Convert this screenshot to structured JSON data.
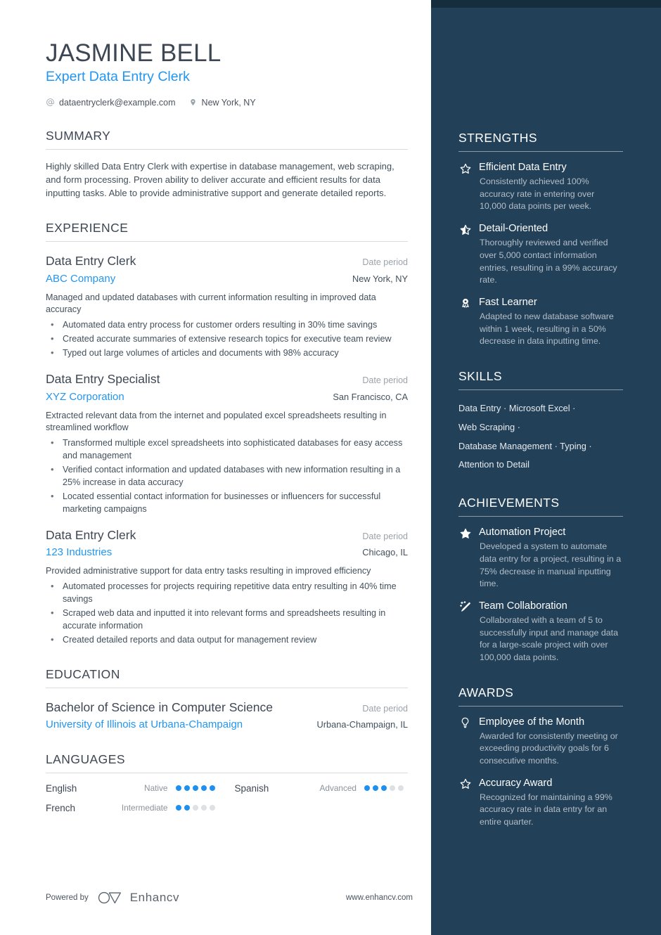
{
  "header": {
    "name": "JASMINE BELL",
    "role": "Expert Data Entry Clerk",
    "email": "dataentryclerk@example.com",
    "location": "New York, NY",
    "email_icon": "at-icon",
    "location_icon": "map-pin-icon"
  },
  "accent_color": "#2196f3",
  "sidebar_color": "#224058",
  "sidebar_topbar_color": "#162d3e",
  "summary": {
    "title": "SUMMARY",
    "text": "Highly skilled Data Entry Clerk with expertise in database management, web scraping, and form processing. Proven ability to deliver accurate and efficient results for data inputting tasks. Able to provide administrative support and generate detailed reports."
  },
  "experience": {
    "title": "EXPERIENCE",
    "entries": [
      {
        "title": "Data Entry Clerk",
        "date": "Date period",
        "org": "ABC Company",
        "location": "New York, NY",
        "desc": "Managed and updated databases with current information resulting in improved data accuracy",
        "bullets": [
          "Automated data entry process for customer orders resulting in 30% time savings",
          "Created accurate summaries of extensive research topics for executive team review",
          "Typed out large volumes of articles and documents with 98% accuracy"
        ]
      },
      {
        "title": "Data Entry Specialist",
        "date": "Date period",
        "org": "XYZ Corporation",
        "location": "San Francisco, CA",
        "desc": "Extracted relevant data from the internet and populated excel spreadsheets resulting in streamlined workflow",
        "bullets": [
          "Transformed multiple excel spreadsheets into sophisticated databases for easy access and management",
          "Verified contact information and updated databases with new information resulting in a 25% increase in data accuracy",
          "Located essential contact information for businesses or influencers for successful marketing campaigns"
        ]
      },
      {
        "title": "Data Entry Clerk",
        "date": "Date period",
        "org": "123 Industries",
        "location": "Chicago, IL",
        "desc": "Provided administrative support for data entry tasks resulting in improved efficiency",
        "bullets": [
          "Automated processes for projects requiring repetitive data entry resulting in 40% time savings",
          "Scraped web data and inputted it into relevant forms and spreadsheets resulting in accurate information",
          "Created detailed reports and data output for management review"
        ]
      }
    ]
  },
  "education": {
    "title": "EDUCATION",
    "entries": [
      {
        "degree": "Bachelor of Science in Computer Science",
        "date": "Date period",
        "school": "University of Illinois at Urbana-Champaign",
        "location": "Urbana-Champaign, IL"
      }
    ]
  },
  "languages": {
    "title": "LANGUAGES",
    "max_dots": 5,
    "items": [
      {
        "name": "English",
        "level": "Native",
        "rating": 5
      },
      {
        "name": "Spanish",
        "level": "Advanced",
        "rating": 3
      },
      {
        "name": "French",
        "level": "Intermediate",
        "rating": 2
      }
    ]
  },
  "strengths": {
    "title": "STRENGTHS",
    "items": [
      {
        "icon": "star-outline-icon",
        "title": "Efficient Data Entry",
        "desc": "Consistently achieved 100% accuracy rate in entering over 10,000 data points per week."
      },
      {
        "icon": "star-half-icon",
        "title": "Detail-Oriented",
        "desc": "Thoroughly reviewed and verified over 5,000 contact information entries, resulting in a 99% accuracy rate."
      },
      {
        "icon": "award-medal-icon",
        "title": "Fast Learner",
        "desc": "Adapted to new database software within 1 week, resulting in a 50% decrease in data inputting time."
      }
    ]
  },
  "skills": {
    "title": "SKILLS",
    "separator": "·",
    "lines": [
      "Data Entry · Microsoft Excel ·",
      "Web Scraping ·",
      "Database Management · Typing ·",
      "Attention to Detail"
    ],
    "items": [
      "Data Entry",
      "Microsoft Excel",
      "Web Scraping",
      "Database Management",
      "Typing",
      "Attention to Detail"
    ]
  },
  "achievements": {
    "title": "ACHIEVEMENTS",
    "items": [
      {
        "icon": "star-filled-icon",
        "title": "Automation Project",
        "desc": "Developed a system to automate data entry for a project, resulting in a 75% decrease in manual inputting time."
      },
      {
        "icon": "magic-wand-icon",
        "title": "Team Collaboration",
        "desc": "Collaborated with a team of 5 to successfully input and manage data for a large-scale project with over 100,000 data points."
      }
    ]
  },
  "awards": {
    "title": "AWARDS",
    "items": [
      {
        "icon": "lightbulb-icon",
        "title": "Employee of the Month",
        "desc": "Awarded for consistently meeting or exceeding productivity goals for 6 consecutive months."
      },
      {
        "icon": "star-outline-icon",
        "title": "Accuracy Award",
        "desc": "Recognized for maintaining a 99% accuracy rate in data entry for an entire quarter."
      }
    ]
  },
  "footer": {
    "powered_by": "Powered by",
    "brand": "Enhancv",
    "brand_logo_icon": "enhancv-logo-icon",
    "website": "www.enhancv.com"
  }
}
